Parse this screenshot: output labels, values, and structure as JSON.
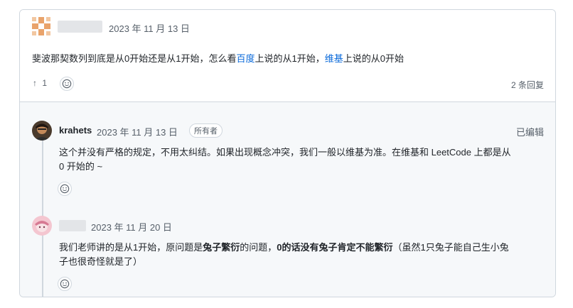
{
  "discussion": {
    "date": "2023 年 11 月 13 日",
    "body_prefix": "斐波那契数列到底是从0开始还是从1开始，怎么看",
    "link_baidu": "百度",
    "body_mid": "上说的从1开始，",
    "link_wiki": "维基",
    "body_suffix": "上说的从0开始",
    "upvote_arrow": "↑",
    "upvote_count": "1",
    "replies_count": "2 条回复"
  },
  "replies": [
    {
      "author": "krahets",
      "date": "2023 年 11 月 13 日",
      "badge": "所有者",
      "edited": "已编辑",
      "line1": "这个并没有严格的规定，不用太纠结。如果出现概念冲突，我们一般以维基为准。在维基和 LeetCode 上都是从",
      "line2": "0 开始的 ~"
    },
    {
      "date": "2023 年 11 月 20 日",
      "text_a": "我们老师讲的是从1开始，原问题是",
      "text_b": "兔子繁衍",
      "text_c": "的问题，",
      "text_d": "0的话没有兔子肯定不能繁衍",
      "text_e": "（虽然1只兔子能自己生小兔",
      "line2": "子也很奇怪就是了）"
    }
  ],
  "icons": {
    "smiley": "smiley-icon",
    "arrow_up": "arrow-up-icon"
  },
  "colors": {
    "link": "#0969da",
    "border": "#d0d7de",
    "muted": "#57606a",
    "reply_bg": "#f6f8fa"
  }
}
